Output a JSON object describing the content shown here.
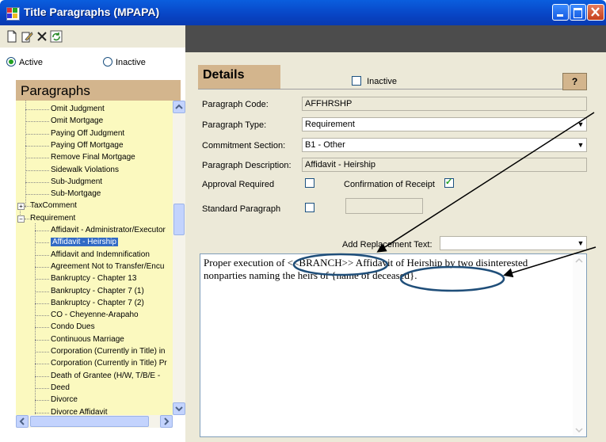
{
  "window": {
    "title": "Title Paragraphs (MPAPA)"
  },
  "toolbar": {
    "icons": [
      "new-icon",
      "edit-icon",
      "delete-icon",
      "refresh-icon"
    ]
  },
  "filter": {
    "active_label": "Active",
    "inactive_label": "Inactive",
    "selected": "Active"
  },
  "paragraphs": {
    "header": "Paragraphs",
    "items": [
      "Omit Judgment",
      "Omit Mortgage",
      "Paying Off Judgment",
      "Paying Off Mortgage",
      "Remove Final Mortgage",
      "Sidewalk Violations",
      "Sub-Judgment",
      "Sub-Mortgage",
      "TaxComment",
      "Requirement",
      "Affidavit - Administrator/Executor",
      "Affidavit - Heirship",
      "Affidavit and Indemnification",
      "Agreement Not to Transfer/Encu",
      "Bankruptcy - Chapter 13",
      "Bankruptcy - Chapter 7 (1)",
      "Bankruptcy - Chapter 7 (2)",
      "CO - Cheyenne-Arapaho",
      "Condo Dues",
      "Continuous Marriage",
      "Corporation (Currently in Title) in",
      "Corporation (Currently in Title) Pr",
      "Death of Grantee (H/W, T/B/E -",
      "Deed",
      "Divorce",
      "Divorce Affidavit"
    ],
    "expander_plus": "+",
    "expander_minus": "−",
    "selected": "Affidavit - Heirship"
  },
  "details": {
    "tab_label": "Details",
    "inactive_label": "Inactive",
    "help_label": "?",
    "code_label": "Paragraph Code:",
    "code_value": "AFFHRSHP",
    "type_label": "Paragraph Type:",
    "type_value": "Requirement",
    "section_label": "Commitment Section:",
    "section_value": "B1 - Other",
    "desc_label": "Paragraph Description:",
    "desc_value": "Affidavit - Heirship",
    "approval_label": "Approval Required",
    "confirmation_label": "Confirmation of Receipt",
    "confirmation_checked": true,
    "standard_label": "Standard Paragraph",
    "standard_value": "",
    "replacement_label": "Add Replacement Text:",
    "replacement_value": "",
    "body_text": "Proper execution of <<BRANCH>> Affidavit of Heirship by two disinterested nonparties naming the heirs of {name of deceased}."
  },
  "annotation": {
    "color": "#1f4e79"
  }
}
